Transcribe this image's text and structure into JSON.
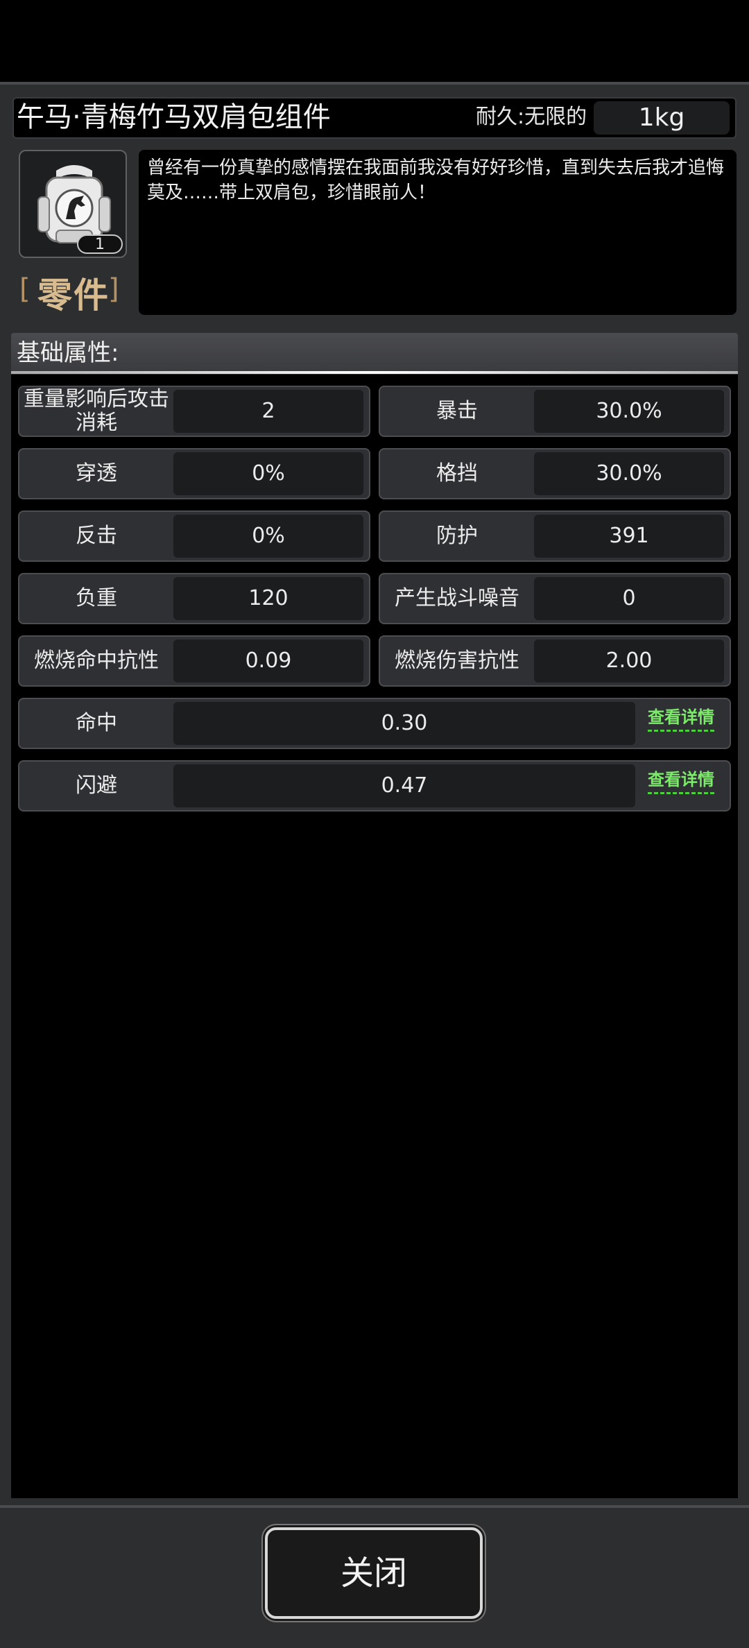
{
  "item": {
    "title": "午马·青梅竹马双肩包组件",
    "durability_label": "耐久:无限的",
    "weight": "1kg",
    "count": "1",
    "category": "零件",
    "category_bracket_left": "[",
    "category_bracket_right": "]",
    "description": "曾经有一份真挚的感情摆在我面前我没有好好珍惜，直到失去后我才追悔莫及……带上双肩包，珍惜眼前人！",
    "icon": "backpack-horse-icon"
  },
  "section": {
    "title": "基础属性:"
  },
  "stats": [
    {
      "label": "重量影响后攻击消耗",
      "value": "2"
    },
    {
      "label": "暴击",
      "value": "30.0%"
    },
    {
      "label": "穿透",
      "value": "0%"
    },
    {
      "label": "格挡",
      "value": "30.0%"
    },
    {
      "label": "反击",
      "value": "0%"
    },
    {
      "label": "防护",
      "value": "391"
    },
    {
      "label": "负重",
      "value": "120"
    },
    {
      "label": "产生战斗噪音",
      "value": "0"
    },
    {
      "label": "燃烧命中抗性",
      "value": "0.09"
    },
    {
      "label": "燃烧伤害抗性",
      "value": "2.00"
    }
  ],
  "wide_stats": [
    {
      "label": "命中",
      "value": "0.30",
      "link": "查看详情"
    },
    {
      "label": "闪避",
      "value": "0.47",
      "link": "查看详情"
    }
  ],
  "footer": {
    "close_label": "关闭"
  },
  "colors": {
    "link": "#7dea6c",
    "category": "#d8bb8e",
    "panel": "#2d2e30"
  }
}
